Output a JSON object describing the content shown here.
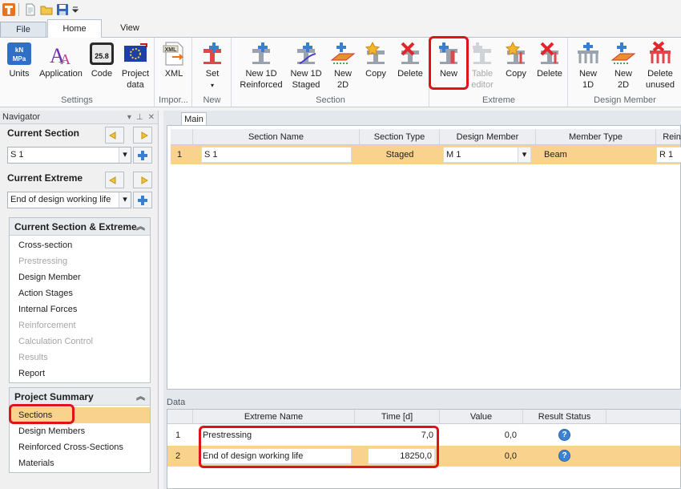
{
  "ribbon_tabs": {
    "file": "File",
    "home": "Home",
    "view": "View"
  },
  "ribbon": {
    "settings": {
      "label": "Settings",
      "units": "Units",
      "application": "Application",
      "code": "Code",
      "project_data_1": "Project",
      "project_data_2": "data",
      "units_icon_text": "kN MPa",
      "code_icon_text": "25.8"
    },
    "import": {
      "label": "Impor...",
      "xml": "XML",
      "xml_icon_text": "XML"
    },
    "new_group": {
      "label": "New",
      "set": "Set"
    },
    "section": {
      "label": "Section",
      "new1d_reinforced_1": "New 1D",
      "new1d_reinforced_2": "Reinforced",
      "new1d_staged_1": "New 1D",
      "new1d_staged_2": "Staged",
      "new2d_1": "New",
      "new2d_2": "2D",
      "copy": "Copy",
      "delete": "Delete"
    },
    "extreme": {
      "label": "Extreme",
      "new": "New",
      "table_editor_1": "Table",
      "table_editor_2": "editor",
      "copy": "Copy",
      "delete": "Delete"
    },
    "design_member": {
      "label": "Design Member",
      "new1d_1": "New",
      "new1d_2": "1D",
      "new2d_1": "New",
      "new2d_2": "2D",
      "delete_unused_1": "Delete",
      "delete_unused_2": "unused"
    }
  },
  "navigator": {
    "title": "Navigator",
    "current_section_label": "Current Section",
    "current_section_value": "S 1",
    "current_extreme_label": "Current Extreme",
    "current_extreme_value": "End of design working life",
    "panel_section_extreme": {
      "title": "Current Section & Extreme",
      "items": [
        {
          "label": "Cross-section",
          "enabled": true
        },
        {
          "label": "Prestressing",
          "enabled": false
        },
        {
          "label": "Design Member",
          "enabled": true
        },
        {
          "label": "Action Stages",
          "enabled": true
        },
        {
          "label": "Internal Forces",
          "enabled": true
        },
        {
          "label": "Reinforcement",
          "enabled": false
        },
        {
          "label": "Calculation Control",
          "enabled": false
        },
        {
          "label": "Results",
          "enabled": false
        },
        {
          "label": "Report",
          "enabled": true
        }
      ]
    },
    "panel_project_summary": {
      "title": "Project Summary",
      "items": [
        {
          "label": "Sections",
          "selected": true
        },
        {
          "label": "Design Members"
        },
        {
          "label": "Reinforced Cross-Sections"
        },
        {
          "label": "Materials"
        }
      ]
    }
  },
  "main": {
    "tab": "Main",
    "columns": [
      "Section Name",
      "Section Type",
      "Design Member",
      "Member Type",
      "Rein"
    ],
    "rows": [
      {
        "index": "1",
        "section_name": "S 1",
        "section_type": "Staged",
        "design_member": "M 1",
        "member_type": "Beam",
        "reinforcement": "R 1"
      }
    ]
  },
  "data": {
    "label": "Data",
    "columns": [
      "Extreme Name",
      "Time [d]",
      "Value",
      "Result Status"
    ],
    "rows": [
      {
        "index": "1",
        "extreme_name": "Prestressing",
        "time": "7,0",
        "value": "0,0",
        "status_icon": "help-icon",
        "status_glyph": "?"
      },
      {
        "index": "2",
        "extreme_name": "End of design working life",
        "time": "18250,0",
        "value": "0,0",
        "status_icon": "help-icon",
        "status_glyph": "?"
      }
    ]
  },
  "colors": {
    "highlight": "#e0121b",
    "selected_row": "#f9d38d",
    "accent_blue": "#3b83d6"
  }
}
